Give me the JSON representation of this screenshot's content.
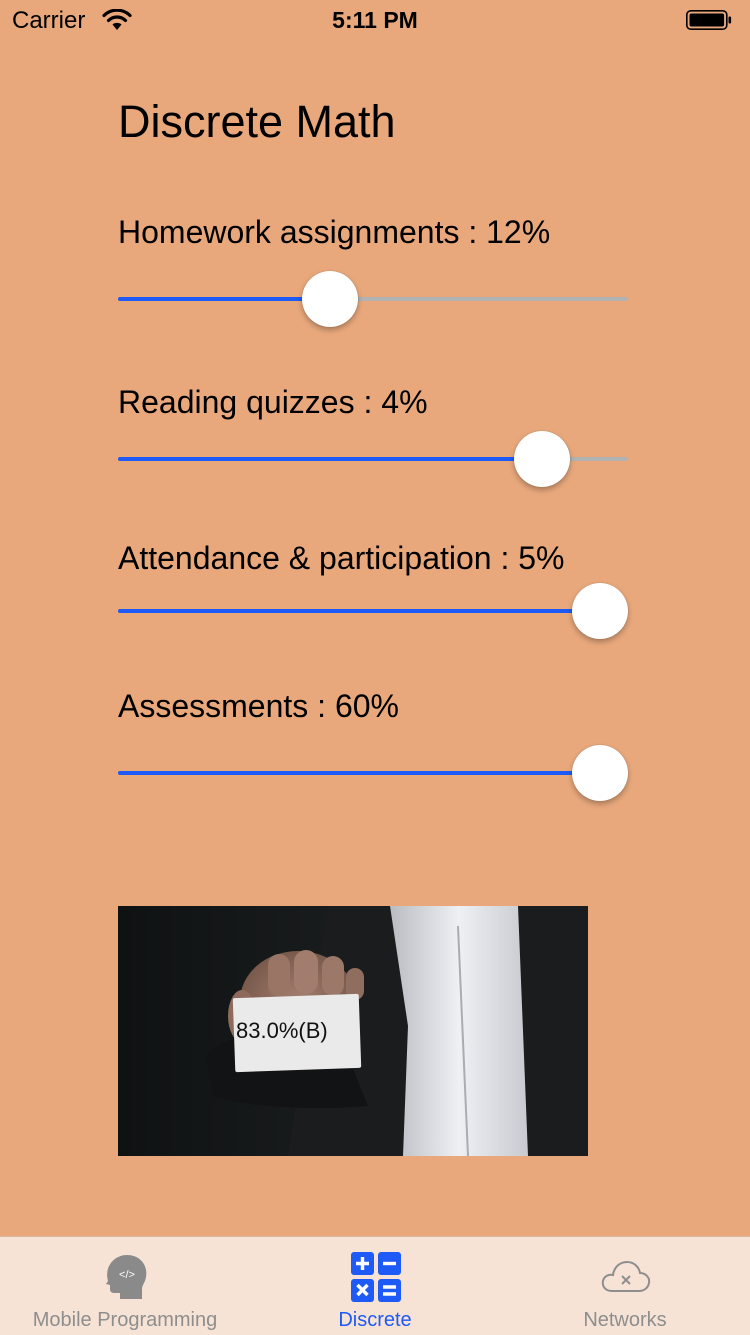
{
  "status_bar": {
    "carrier": "Carrier",
    "time": "5:11 PM"
  },
  "page": {
    "title": "Discrete Math"
  },
  "sliders": [
    {
      "label": "Homework assignments :  12%",
      "fraction": 0.44
    },
    {
      "label": "Reading quizzes :   4%",
      "fraction": 0.88
    },
    {
      "label": "Attendance & participation :  5%",
      "fraction": 1.0
    },
    {
      "label": "Assessments :  60%",
      "fraction": 1.0
    }
  ],
  "result": {
    "grade_text": "83.0%(B)"
  },
  "tab_bar": {
    "tabs": [
      {
        "label": "Mobile Programming",
        "icon": "head-code-icon",
        "active": false
      },
      {
        "label": "Discrete",
        "icon": "calculator-icon",
        "active": true
      },
      {
        "label": "Networks",
        "icon": "cloud-error-icon",
        "active": false
      }
    ]
  },
  "colors": {
    "background": "#E8A87C",
    "accent": "#1E5AF6",
    "track": "#B2B2B2",
    "tab_bar": "#F6E3D6"
  }
}
